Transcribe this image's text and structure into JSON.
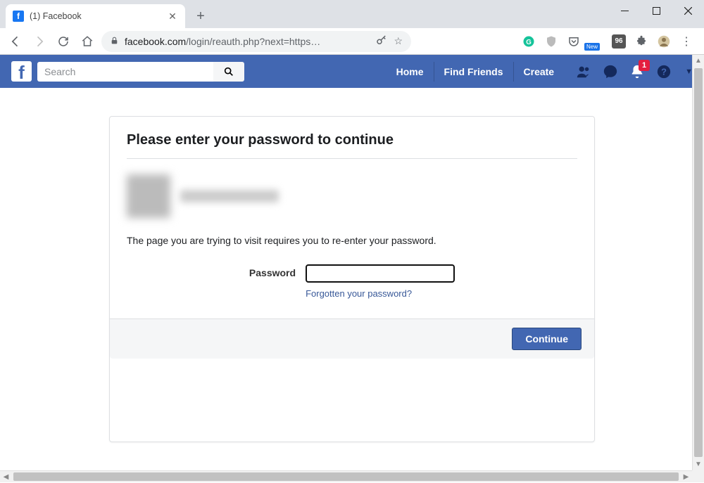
{
  "browser": {
    "tab": {
      "title": "(1) Facebook",
      "favicon_letter": "f"
    },
    "url_domain": "facebook.com",
    "url_path": "/login/reauth.php?next=https…",
    "extensions": {
      "new_label": "New",
      "counter_value": "96"
    }
  },
  "fbheader": {
    "logo_letter": "f",
    "search_placeholder": "Search",
    "nav": {
      "home": "Home",
      "find_friends": "Find Friends",
      "create": "Create"
    },
    "notif_count": "1"
  },
  "card": {
    "title": "Please enter your password to continue",
    "explain": "The page you are trying to visit requires you to re-enter your password.",
    "password_label": "Password",
    "forgot_link": "Forgotten your password?",
    "continue_button": "Continue"
  }
}
